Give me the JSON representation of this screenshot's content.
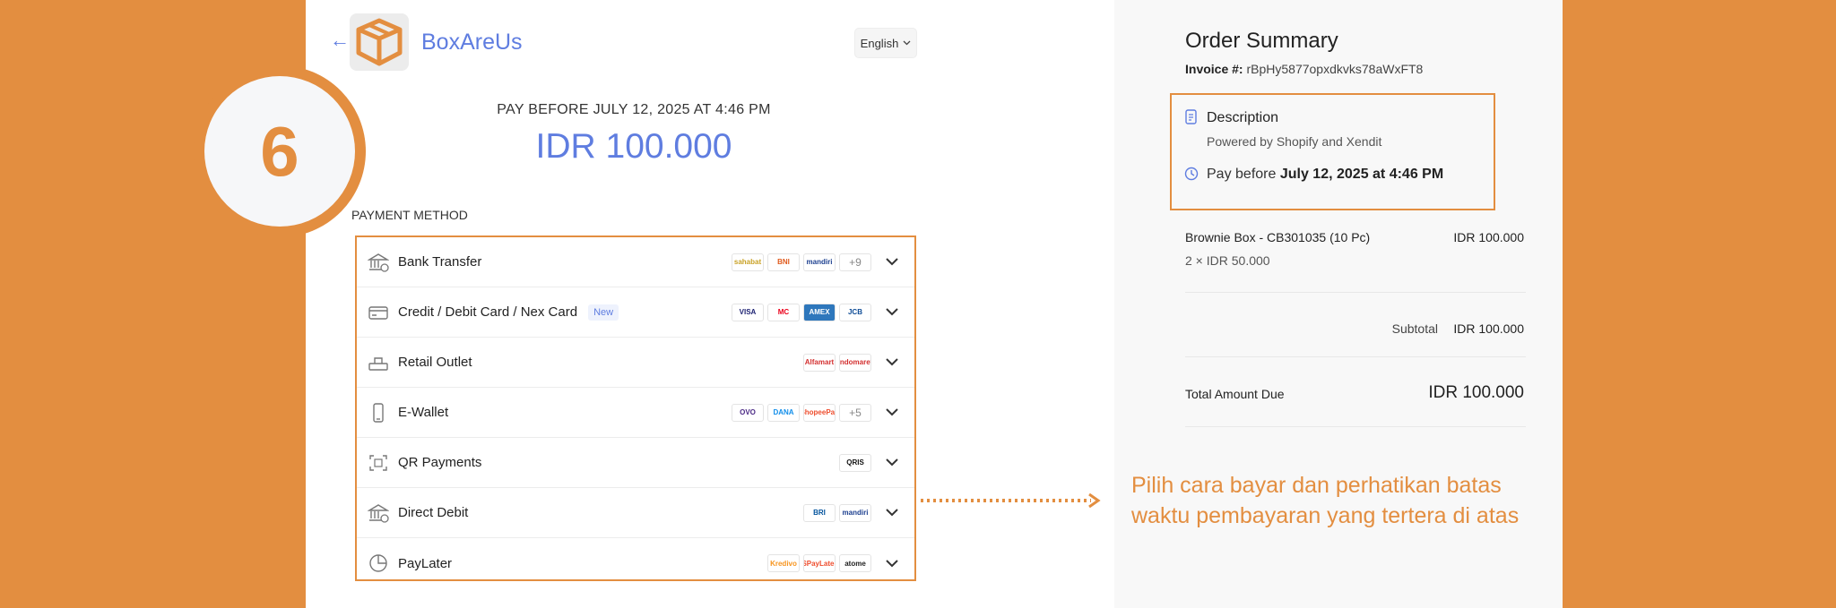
{
  "step": "6",
  "header": {
    "back_arrow": "←",
    "logo_icon": "box-logo",
    "brand": "BoxAreUs",
    "language": "English"
  },
  "payment": {
    "pay_before": "PAY BEFORE JULY 12, 2025 AT 4:46 PM",
    "amount": "IDR 100.000",
    "method_label": "PAYMENT METHOD",
    "methods": [
      {
        "label": "Bank Transfer",
        "icon": "bank-icon",
        "logos": [
          "sahabat",
          "BNI",
          "mandiri"
        ],
        "more": "+9"
      },
      {
        "label": "Credit / Debit Card / Nex Card",
        "icon": "card-icon",
        "badge": "New",
        "logos": [
          "VISA",
          "MC",
          "AMEX",
          "JCB"
        ]
      },
      {
        "label": "Retail Outlet",
        "icon": "store-icon",
        "logos": [
          "Alfamart",
          "Indomaret"
        ]
      },
      {
        "label": "E-Wallet",
        "icon": "phone-icon",
        "logos": [
          "OVO",
          "DANA",
          "ShopeePay"
        ],
        "more": "+5"
      },
      {
        "label": "QR Payments",
        "icon": "qr-icon",
        "logos": [
          "QRIS"
        ]
      },
      {
        "label": "Direct Debit",
        "icon": "bank-icon",
        "logos": [
          "BRI",
          "mandiri"
        ]
      },
      {
        "label": "PayLater",
        "icon": "clock-pie-icon",
        "logos": [
          "Kredivo",
          "SPayLater",
          "atome"
        ]
      }
    ]
  },
  "caption": "Pilih cara bayar dan perhatikan batas waktu pembayaran yang tertera di atas",
  "summary": {
    "title": "Order Summary",
    "invoice_label": "Invoice #:",
    "invoice_value": "rBpHy5877opxdkvks78aWxFT8",
    "description_title": "Description",
    "description_text": "Powered by Shopify and Xendit",
    "pay_before_prefix": "Pay before",
    "pay_before_date": "July 12, 2025 at 4:46 PM",
    "item_name": "Brownie Box - CB301035 (10 Pc)",
    "item_qty": "2 × IDR 50.000",
    "item_price": "IDR 100.000",
    "subtotal_label": "Subtotal",
    "subtotal_value": "IDR 100.000",
    "total_label": "Total Amount Due",
    "total_value": "IDR 100.000"
  },
  "colors": {
    "accent_orange": "#E38E40",
    "brand_blue": "#5f7de0"
  }
}
